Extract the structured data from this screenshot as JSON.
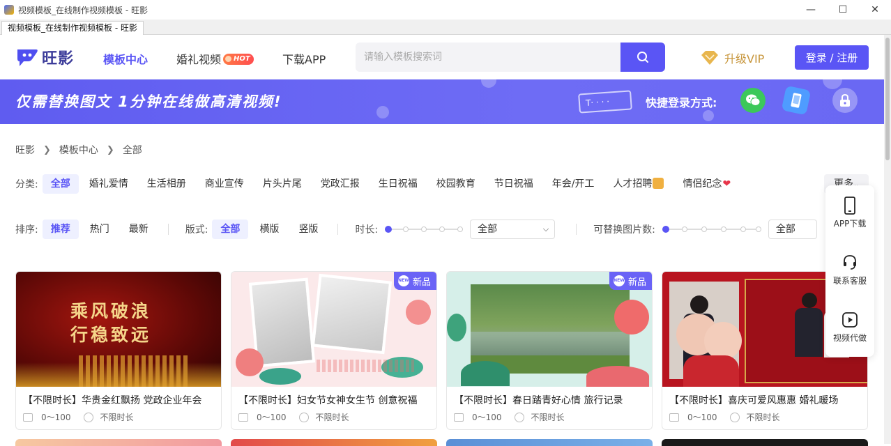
{
  "window": {
    "title": "视频模板_在线制作视频模板 - 旺影",
    "tab_label": "视频模板_在线制作视频模板 - 旺影",
    "controls": [
      "—",
      "☐",
      "✕"
    ]
  },
  "header": {
    "logo_text": "旺影",
    "nav": [
      {
        "label": "模板中心",
        "active": true
      },
      {
        "label": "婚礼视频",
        "badge": "HOT"
      },
      {
        "label": "下载APP"
      }
    ],
    "search_placeholder": "请输入模板搜索词",
    "vip_label": "升级VIP",
    "login_label": "登录 / 注册"
  },
  "banner": {
    "slogan": "仅需替换图文 1分钟在线做高清视频!",
    "tag_text": "T· · · ·",
    "quick_login_label": "快捷登录方式:",
    "quick_login_icons": [
      "wechat-icon",
      "phone-icon",
      "lock-icon"
    ]
  },
  "breadcrumb": [
    "旺影",
    "模板中心",
    "全部"
  ],
  "categories": {
    "label": "分类:",
    "items": [
      "全部",
      "婚礼爱情",
      "生活相册",
      "商业宣传",
      "片头片尾",
      "党政汇报",
      "生日祝福",
      "校园教育",
      "节日祝福",
      "年会/开工",
      "人才招聘",
      "情侣纪念"
    ],
    "active_index": 0,
    "more_label": "更多"
  },
  "filters": {
    "sort_label": "排序:",
    "sort_options": [
      "推荐",
      "热门",
      "最新"
    ],
    "sort_active": 0,
    "format_label": "版式:",
    "format_options": [
      "全部",
      "横版",
      "竖版"
    ],
    "format_active": 0,
    "duration_label": "时长:",
    "duration_select": "全部",
    "photo_count_label": "可替换图片数:",
    "photo_count_select": "全部"
  },
  "cards": [
    {
      "title": "【不限时长】华贵金红飘扬 党政企业年会",
      "photos": "0～100",
      "duration": "不限时长",
      "is_new": false,
      "thumb_text": "乘风破浪 行稳致远"
    },
    {
      "title": "【不限时长】妇女节女神女生节 创意祝福",
      "photos": "0～100",
      "duration": "不限时长",
      "is_new": true,
      "new_label": "新品"
    },
    {
      "title": "【不限时长】春日踏青好心情 旅行记录",
      "photos": "0～100",
      "duration": "不限时长",
      "is_new": true,
      "new_label": "新品"
    },
    {
      "title": "【不限时长】喜庆可爱风惠惠 婚礼暖场",
      "photos": "0～100",
      "duration": "不限时长",
      "is_new": false
    }
  ],
  "side_tools": [
    {
      "label": "APP下载",
      "icon": "mobile-icon"
    },
    {
      "label": "联系客服",
      "icon": "headset-icon"
    },
    {
      "label": "视频代做",
      "icon": "play-icon"
    }
  ],
  "colors": {
    "accent": "#5a55f5",
    "vip_gold": "#c7953a",
    "banner": "#6a68f3"
  }
}
